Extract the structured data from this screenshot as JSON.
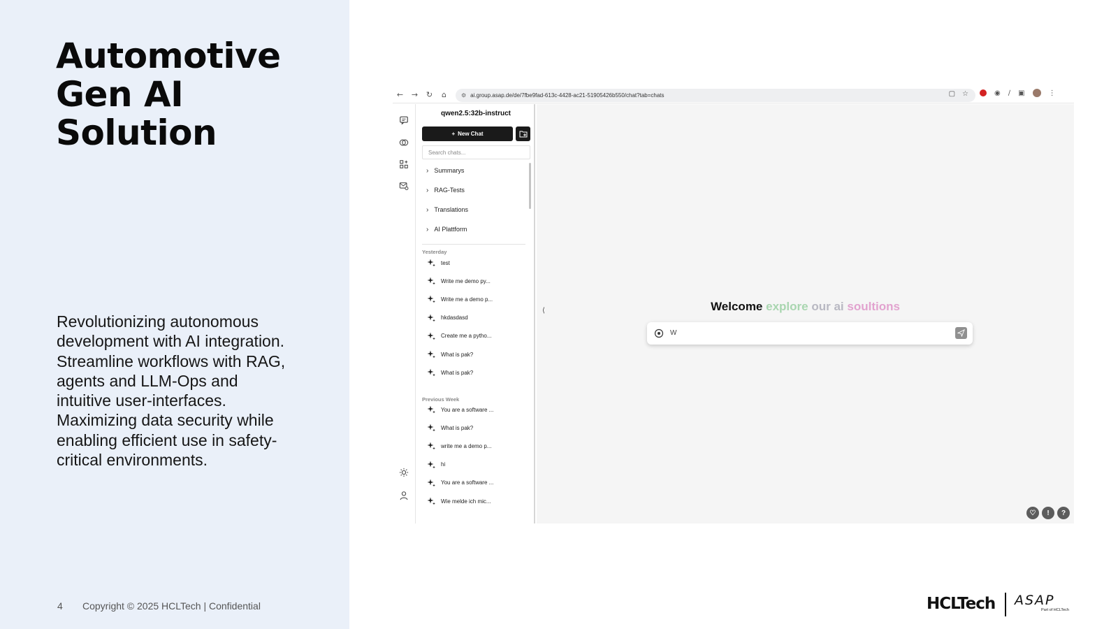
{
  "slide": {
    "title_lines": [
      "Automotive",
      "Gen AI",
      "Solution"
    ],
    "body": "Revolutionizing autonomous development with AI integration. Streamline workflows with RAG, agents and LLM-Ops and intuitive user-interfaces. Maximizing data security while enabling efficient use in safety-critical environments.",
    "page_number": "4",
    "copyright": "Copyright © 2025 HCLTech | Confidential"
  },
  "browser": {
    "url": "ai.group.asap.de/de/7fbe9fad-613c-4428-ac21-51905426b550/chat?tab=chats",
    "nav_icons": [
      "back-icon",
      "forward-icon",
      "reload-icon",
      "home-icon"
    ]
  },
  "app": {
    "model_name": "qwen2.5:32b-instruct",
    "new_chat_label": "New Chat",
    "search_placeholder": "Search chats...",
    "folders": [
      "Summarys",
      "RAG-Tests",
      "Translations",
      "AI Plattform"
    ],
    "groups": [
      {
        "label": "Yesterday",
        "items": [
          "test",
          "Write me demo py...",
          "Write me a demo p...",
          "hkdasdasd",
          "Create me a pytho...",
          "What is pak?",
          "What is pak?"
        ]
      },
      {
        "label": "Previous Week",
        "items": [
          "You are a software ...",
          "What is pak?",
          "write me a demo p...",
          "hi",
          "You are a software ...",
          "Wie melde ich mic..."
        ]
      }
    ],
    "welcome": {
      "w1": "Welcome",
      "w2": "explore",
      "w3": "our ai",
      "w4": "soultions"
    },
    "prompt_value": "W",
    "collapse_glyph": "⟨",
    "corner_icons": [
      "shield-icon",
      "info-icon",
      "help-icon"
    ],
    "corner_glyphs": [
      "♡",
      "!",
      "?"
    ]
  },
  "logos": {
    "hcltech": "HCLTech",
    "asap": "ASAP",
    "asap_sub": "Part of HCLTech"
  },
  "colors": {
    "left_panel_bg": "#eaf0f9",
    "welcome_green": "#a9d6b0",
    "welcome_gray": "#b8b8c2",
    "welcome_pink": "#e2a3cf",
    "new_chat_bg": "#1a1a1a"
  }
}
